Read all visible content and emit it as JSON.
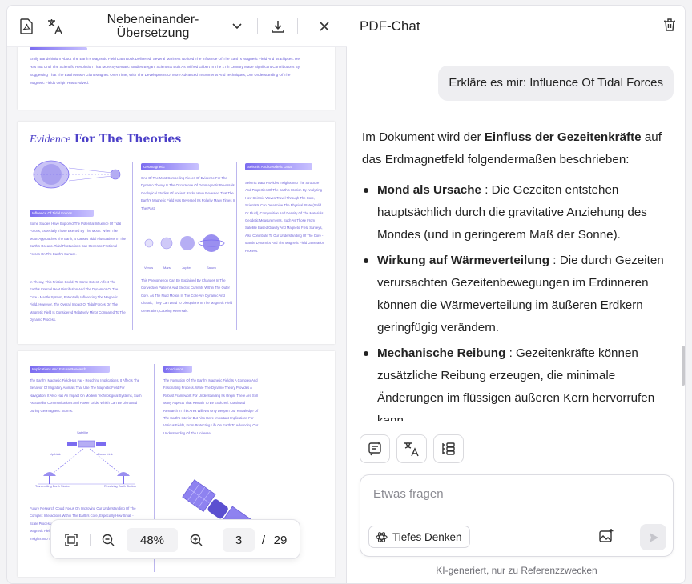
{
  "left_toolbar": {
    "title": "Nebeneinander-Übersetzung",
    "pdf_icon": "pdf-file-icon",
    "translate_icon": "translate-icon",
    "chevron_icon": "chevron-down-icon",
    "download_icon": "download-icon",
    "close_icon": "close-icon"
  },
  "page1": {
    "text": "Emily Bandshinium About The Earth's Magnetic Field Data Book Delivered. Several Mariners Noticed The Influence Of The Earth's Magnetic Field And Its Ellipses. He Has Not Until The Scientific Revolution That More Systematic Studies Began. Scientists Built As Wilfred Gilbert In The 17th Century Made Significant Contributions By Suggesting That The Earth Was A Giant Magnet. Over Time, With The Development Of More Advanced Instruments And Techniques, Our Understanding Of The Magnetic Fields Origin Has Evolved."
  },
  "page2": {
    "title_italic": "Evidence",
    "title_rest": "For The Theories",
    "col1_heading": "Influence Of Tidal Forces",
    "col1_text": "Some Studies Have Explored The Potential Influence Of Tidal Forces, Especially Those Exerted By The Moon. When The Moon Approaches The Earth, It Causes Tidal Fluctuations In The Earth's Oceans. Tidal Fluctuations Can Generate Frictional Forces On The Earth's Surface.",
    "col1_text2": "In Theory, This Friction Could, To Some Extent, Affect The Earth's Internal Heat Distribution And The Dynamics Of The Core - Mantle System, Potentially Influencing The Magnetic Field. However, The Overall Impact Of Tidal Forces On The Magnetic Field Is Considered Relatively Minor Compared To The Dynamo Process.",
    "col2_heading": "Geomagnetic",
    "col2_text": "One Of The Most Compelling Pieces Of Evidence For The Dynamo Theory Is The Occurrence Of Geomagnetic Reversals. Geological Studies Of Ancient Rocks Have Revealed That The Earth's Magnetic Field Has Reversed Its Polarity Many Times In The Past.",
    "col2_text2": "This Phenomenon Can Be Explained By Changes In The Convection Patterns And Electric Currents Within The Outer Core. As The Fluid Motion In The Core Are Dynamic And Chaotic, They Can Lead To Disruptions In The Magnetic Field Generation, Causing Reversals.",
    "planets": [
      "Venus",
      "Mars",
      "Jupiter",
      "Saturn"
    ],
    "col3_heading": "Seismic And Geodetic Data",
    "col3_text": "Seismic Data Provides Insights Into The Structure And Properties Of The Earth's Interior. By Analyzing How Seismic Waves Travel Through The Core, Scientists Can Determine The Physical State (Solid Or Fluid), Composition And Density Of The Materials. Geodetic Measurements, Such As Those From Satellite Based Gravity And Magnetic Field Surveys, Also Contribute To Our Understanding Of The Core - Mantle Dynamics And The Magnetic Field Generation Process."
  },
  "page3": {
    "col1_heading": "Implications And Future Research",
    "col1_text": "The Earth's Magnetic Field Has Far - Reaching Implications. It Affects The Behavior Of Migratory Animals That Use The Magnetic Field For Navigation. It Also Has An Impact On Modern Technological Systems, Such As Satellite Communications And Power Grids, Which Can Be Disrupted During Geomagnetic Storms.",
    "satellite_label": "Satellite",
    "uplink_label": "Up Link",
    "downlink_label": "Down Link",
    "tx_label": "Transmitting Earth Station",
    "rx_label": "Receiving Earth Station",
    "col1_text2": "Future Research Could Focus On Improving Our Understanding Of The Complex Interactions Within The Earth's Core, Especially How Small - Scale Processes Contribute To The Large - Scale Behavior Of The Magnetic Field. Other Models And Simulations Could Provide Further Insights Into The Field's Origin.",
    "col2_heading": "Conclusion",
    "col2_text": "The Formation Of The Earth's Magnetic Field Is A Complex And Fascinating Process. While The Dynamo Theory Provides A Robust Framework For Understanding Its Origin, There Are Still Many Aspects That Remain To Be Explored. Continued Research In This Area Will Not Only Deepen Our Knowledge Of The Earth's Interior But Also Have Important Implications For Various Fields, From Protecting Life On Earth To Advancing Our Understanding Of The Universe."
  },
  "zoom": {
    "fit_icon": "fit-page-icon",
    "zoom_out_icon": "zoom-out-icon",
    "zoom_value": "48%",
    "zoom_in_icon": "zoom-in-icon",
    "current_page": "3",
    "separator": "/",
    "total_pages": "29"
  },
  "chat": {
    "title": "PDF-Chat",
    "trash_icon": "trash-icon",
    "user_message": "Erkläre es mir: Influence Of Tidal Forces",
    "intro_before": "Im Dokument wird der ",
    "intro_bold": "Einfluss der Gezeitenkräfte",
    "intro_after": " auf das Erdmagnetfeld folgendermaßen beschrieben:",
    "bullets": [
      {
        "bold": "Mond als Ursache",
        "text": " : Die Gezeiten entstehen hauptsächlich durch die gravitative Anziehung des Mondes (und in geringerem Maß der Sonne)."
      },
      {
        "bold": "Wirkung auf Wärmeverteilung",
        "text": " : Die durch Gezeiten verursachten Gezeitenbewegungen im Erdinneren können die Wärmeverteilung im äußeren Erdkern geringfügig verändern."
      },
      {
        "bold": "Mechanische Reibung",
        "text": " : Gezeitenkräfte können zusätzliche Reibung erzeugen, die minimale Änderungen im flüssigen äußeren Kern hervorrufen kann."
      }
    ],
    "tool_summarize_icon": "summarize-icon",
    "tool_translate_icon": "translate-icon",
    "tool_outline_icon": "outline-icon",
    "input_placeholder": "Etwas fragen",
    "deep_think_label": "Tiefes Denken",
    "deep_think_icon": "atom-icon",
    "image_add_icon": "image-add-icon",
    "send_icon": "send-icon",
    "footer": "KI-generiert, nur zu Referenzzwecken"
  },
  "colors": {
    "accent": "#6b5fd8",
    "send_disabled": "#ececef"
  }
}
